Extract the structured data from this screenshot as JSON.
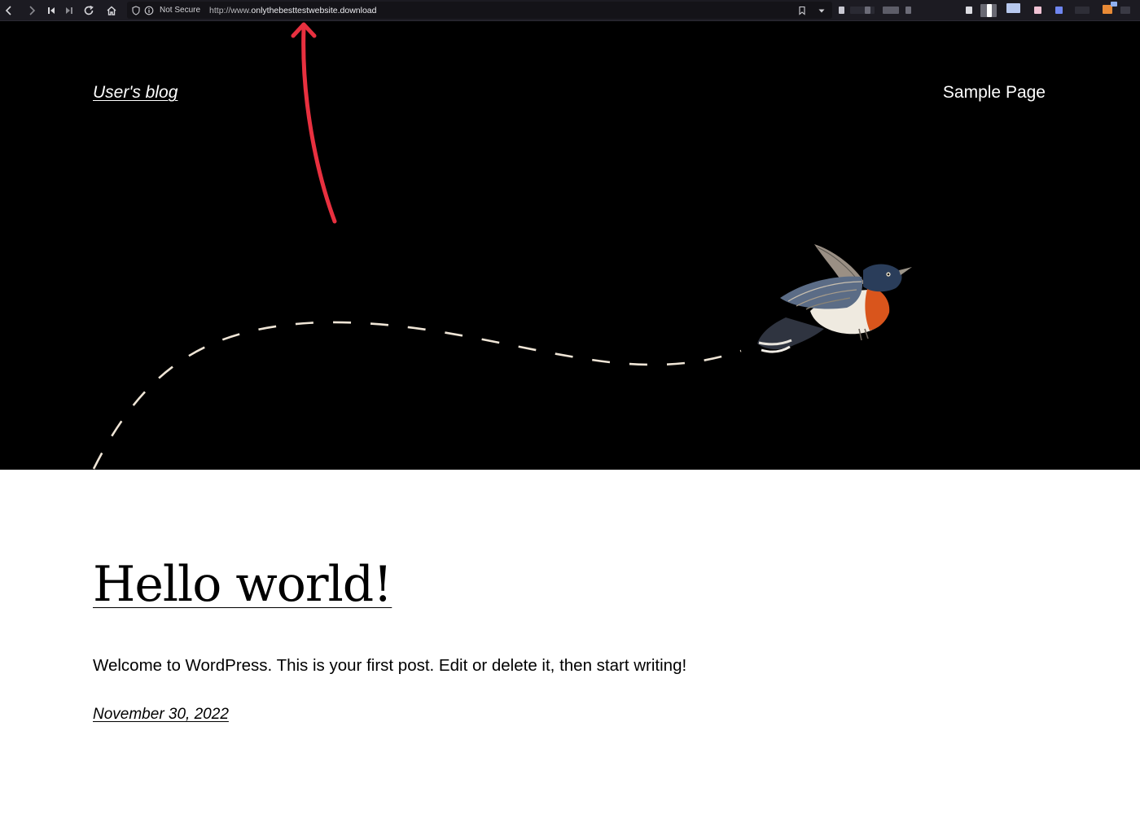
{
  "browser": {
    "security_label": "Not Secure",
    "url_scheme": "http://www.",
    "url_host": "onlythebesttestwebsite.download"
  },
  "site": {
    "title": "User's blog",
    "nav": [
      {
        "label": "Sample Page"
      }
    ]
  },
  "post": {
    "title": "Hello world!",
    "excerpt": "Welcome to WordPress. This is your first post. Edit or delete it, then start writing!",
    "date": "November 30, 2022"
  },
  "colors": {
    "toolbar_bg": "#1c1b22",
    "hero_bg": "#000000",
    "dash_line": "#efe5d6",
    "annotation_arrow": "#e8303f"
  },
  "icons": [
    "back-icon",
    "forward-icon",
    "first-icon",
    "last-icon",
    "reload-icon",
    "home-icon",
    "shield-icon",
    "info-icon",
    "bookmark-icon",
    "dropdown-icon"
  ]
}
